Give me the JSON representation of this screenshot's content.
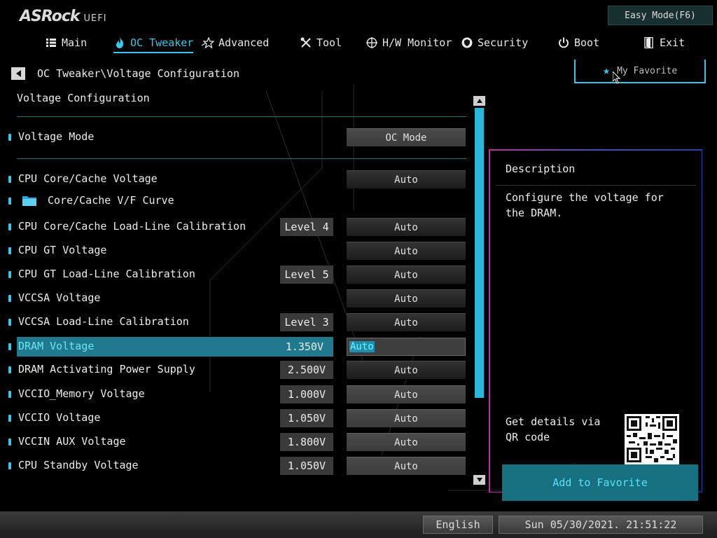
{
  "brand": {
    "name": "ASRock",
    "sub": "UEFI"
  },
  "easy_mode_label": "Easy Mode(F6)",
  "tabs": [
    {
      "label": "Main",
      "icon": "list-icon"
    },
    {
      "label": "OC Tweaker",
      "icon": "flame-icon",
      "active": true
    },
    {
      "label": "Advanced",
      "icon": "star-advanced-icon"
    },
    {
      "label": "Tool",
      "icon": "tools-icon"
    },
    {
      "label": "H/W Monitor",
      "icon": "monitor-icon"
    },
    {
      "label": "Security",
      "icon": "shield-icon"
    },
    {
      "label": "Boot",
      "icon": "power-icon"
    },
    {
      "label": "Exit",
      "icon": "exit-door-icon"
    }
  ],
  "breadcrumb": "OC Tweaker\\Voltage Configuration",
  "my_favorite": "My Favorite",
  "section_title": "Voltage Configuration",
  "settings": [
    {
      "label": "Voltage Mode",
      "value": "OC Mode"
    },
    {
      "label": "CPU Core/Cache Voltage",
      "value": "Auto"
    },
    {
      "label": "Core/Cache V/F Curve"
    },
    {
      "label": "CPU Core/Cache Load-Line Calibration",
      "current": "Level 4",
      "value": "Auto"
    },
    {
      "label": "CPU GT Voltage",
      "value": "Auto"
    },
    {
      "label": "CPU GT Load-Line Calibration",
      "current": "Level 5",
      "value": "Auto"
    },
    {
      "label": "VCCSA Voltage",
      "value": "Auto"
    },
    {
      "label": "VCCSA Load-Line Calibration",
      "current": "Level 3",
      "value": "Auto"
    },
    {
      "label": "DRAM Voltage",
      "current": "1.350V",
      "value": "Auto",
      "selected": true
    },
    {
      "label": "DRAM Activating Power Supply",
      "current": "2.500V",
      "value": "Auto"
    },
    {
      "label": "VCCIO_Memory Voltage",
      "current": "1.000V",
      "value": "Auto"
    },
    {
      "label": "VCCIO Voltage",
      "current": "1.050V",
      "value": "Auto"
    },
    {
      "label": "VCCIN AUX Voltage",
      "current": "1.800V",
      "value": "Auto"
    },
    {
      "label": "CPU Standby Voltage",
      "current": "1.050V",
      "value": "Auto"
    }
  ],
  "description": {
    "title": "Description",
    "text": "Configure the voltage for the DRAM.",
    "qr_text": "Get details via QR code",
    "add_favorite": "Add to Favorite"
  },
  "footer": {
    "language": "English",
    "datetime": "Sun 05/30/2021. 21:51:22"
  },
  "colors": {
    "accent": "#38c7ea",
    "selected_row": "#1e7a8c",
    "add_favorite_bg": "#15707f"
  }
}
